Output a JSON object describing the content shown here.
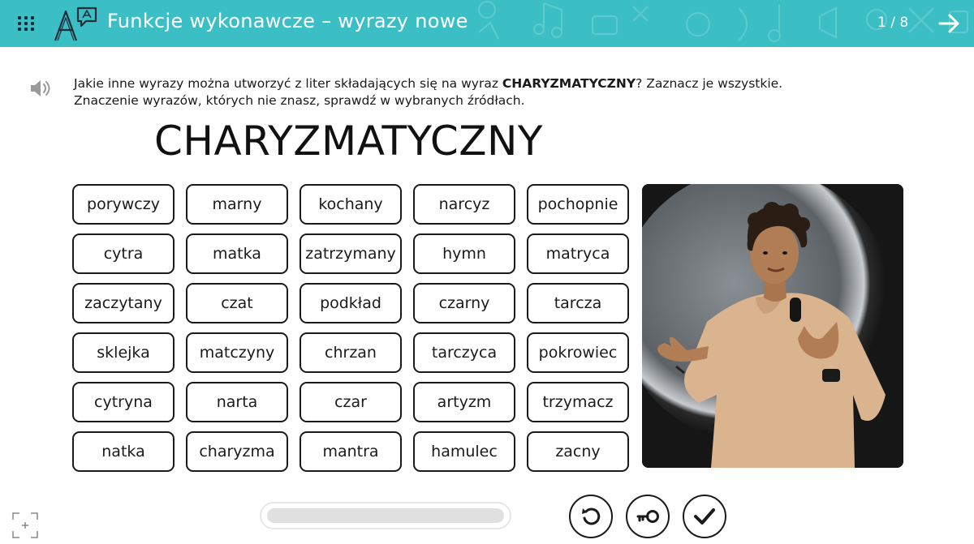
{
  "header": {
    "menu_icon": "grid-menu-icon",
    "logo_icon": "letters-logo-icon",
    "title": "Funkcje wykonawcze – wyrazy nowe",
    "page_indicator": "1 / 8",
    "next_icon": "arrow-right-icon",
    "background_color": "#3bbfc4"
  },
  "instruction": {
    "speaker_icon": "speaker-icon",
    "text_before": "Jakie inne wyrazy można utworzyć z liter składających się na wyraz ",
    "keyword": "CHARYZMATYCZNY",
    "text_after": "? Zaznacz je wszystkie.",
    "line2": "Znaczenie wyrazów, których nie znasz, sprawdź w wybranych źródłach."
  },
  "main_word": "CHARYZMATYCZNY",
  "words": [
    "porywczy",
    "marny",
    "kochany",
    "narcyz",
    "pochopnie",
    "cytra",
    "matka",
    "zatrzymany",
    "hymn",
    "matryca",
    "zaczytany",
    "czat",
    "podkład",
    "czarny",
    "tarcza",
    "sklejka",
    "matczyny",
    "chrzan",
    "tarczyca",
    "pokrowiec",
    "cytryna",
    "narta",
    "czar",
    "artyzm",
    "trzymacz",
    "natka",
    "charyzma",
    "mantra",
    "hamulec",
    "zacny"
  ],
  "photo": {
    "icon": "comedian-photo"
  },
  "progress": {
    "value": 0
  },
  "controls": {
    "reset_icon": "reset-icon",
    "key_icon": "key-icon",
    "check_icon": "check-icon",
    "fullscreen_icon": "fullscreen-icon"
  }
}
